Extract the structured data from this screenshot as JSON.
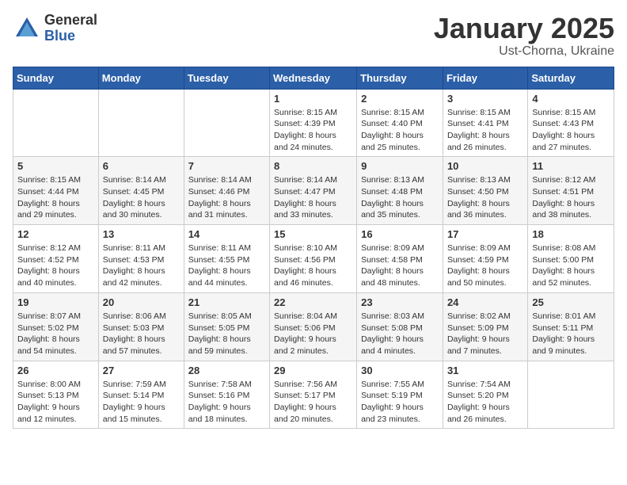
{
  "logo": {
    "general": "General",
    "blue": "Blue"
  },
  "title": {
    "month": "January 2025",
    "location": "Ust-Chorna, Ukraine"
  },
  "weekdays": [
    "Sunday",
    "Monday",
    "Tuesday",
    "Wednesday",
    "Thursday",
    "Friday",
    "Saturday"
  ],
  "weeks": [
    [
      {
        "day": "",
        "info": ""
      },
      {
        "day": "",
        "info": ""
      },
      {
        "day": "",
        "info": ""
      },
      {
        "day": "1",
        "info": "Sunrise: 8:15 AM\nSunset: 4:39 PM\nDaylight: 8 hours\nand 24 minutes."
      },
      {
        "day": "2",
        "info": "Sunrise: 8:15 AM\nSunset: 4:40 PM\nDaylight: 8 hours\nand 25 minutes."
      },
      {
        "day": "3",
        "info": "Sunrise: 8:15 AM\nSunset: 4:41 PM\nDaylight: 8 hours\nand 26 minutes."
      },
      {
        "day": "4",
        "info": "Sunrise: 8:15 AM\nSunset: 4:43 PM\nDaylight: 8 hours\nand 27 minutes."
      }
    ],
    [
      {
        "day": "5",
        "info": "Sunrise: 8:15 AM\nSunset: 4:44 PM\nDaylight: 8 hours\nand 29 minutes."
      },
      {
        "day": "6",
        "info": "Sunrise: 8:14 AM\nSunset: 4:45 PM\nDaylight: 8 hours\nand 30 minutes."
      },
      {
        "day": "7",
        "info": "Sunrise: 8:14 AM\nSunset: 4:46 PM\nDaylight: 8 hours\nand 31 minutes."
      },
      {
        "day": "8",
        "info": "Sunrise: 8:14 AM\nSunset: 4:47 PM\nDaylight: 8 hours\nand 33 minutes."
      },
      {
        "day": "9",
        "info": "Sunrise: 8:13 AM\nSunset: 4:48 PM\nDaylight: 8 hours\nand 35 minutes."
      },
      {
        "day": "10",
        "info": "Sunrise: 8:13 AM\nSunset: 4:50 PM\nDaylight: 8 hours\nand 36 minutes."
      },
      {
        "day": "11",
        "info": "Sunrise: 8:12 AM\nSunset: 4:51 PM\nDaylight: 8 hours\nand 38 minutes."
      }
    ],
    [
      {
        "day": "12",
        "info": "Sunrise: 8:12 AM\nSunset: 4:52 PM\nDaylight: 8 hours\nand 40 minutes."
      },
      {
        "day": "13",
        "info": "Sunrise: 8:11 AM\nSunset: 4:53 PM\nDaylight: 8 hours\nand 42 minutes."
      },
      {
        "day": "14",
        "info": "Sunrise: 8:11 AM\nSunset: 4:55 PM\nDaylight: 8 hours\nand 44 minutes."
      },
      {
        "day": "15",
        "info": "Sunrise: 8:10 AM\nSunset: 4:56 PM\nDaylight: 8 hours\nand 46 minutes."
      },
      {
        "day": "16",
        "info": "Sunrise: 8:09 AM\nSunset: 4:58 PM\nDaylight: 8 hours\nand 48 minutes."
      },
      {
        "day": "17",
        "info": "Sunrise: 8:09 AM\nSunset: 4:59 PM\nDaylight: 8 hours\nand 50 minutes."
      },
      {
        "day": "18",
        "info": "Sunrise: 8:08 AM\nSunset: 5:00 PM\nDaylight: 8 hours\nand 52 minutes."
      }
    ],
    [
      {
        "day": "19",
        "info": "Sunrise: 8:07 AM\nSunset: 5:02 PM\nDaylight: 8 hours\nand 54 minutes."
      },
      {
        "day": "20",
        "info": "Sunrise: 8:06 AM\nSunset: 5:03 PM\nDaylight: 8 hours\nand 57 minutes."
      },
      {
        "day": "21",
        "info": "Sunrise: 8:05 AM\nSunset: 5:05 PM\nDaylight: 8 hours\nand 59 minutes."
      },
      {
        "day": "22",
        "info": "Sunrise: 8:04 AM\nSunset: 5:06 PM\nDaylight: 9 hours\nand 2 minutes."
      },
      {
        "day": "23",
        "info": "Sunrise: 8:03 AM\nSunset: 5:08 PM\nDaylight: 9 hours\nand 4 minutes."
      },
      {
        "day": "24",
        "info": "Sunrise: 8:02 AM\nSunset: 5:09 PM\nDaylight: 9 hours\nand 7 minutes."
      },
      {
        "day": "25",
        "info": "Sunrise: 8:01 AM\nSunset: 5:11 PM\nDaylight: 9 hours\nand 9 minutes."
      }
    ],
    [
      {
        "day": "26",
        "info": "Sunrise: 8:00 AM\nSunset: 5:13 PM\nDaylight: 9 hours\nand 12 minutes."
      },
      {
        "day": "27",
        "info": "Sunrise: 7:59 AM\nSunset: 5:14 PM\nDaylight: 9 hours\nand 15 minutes."
      },
      {
        "day": "28",
        "info": "Sunrise: 7:58 AM\nSunset: 5:16 PM\nDaylight: 9 hours\nand 18 minutes."
      },
      {
        "day": "29",
        "info": "Sunrise: 7:56 AM\nSunset: 5:17 PM\nDaylight: 9 hours\nand 20 minutes."
      },
      {
        "day": "30",
        "info": "Sunrise: 7:55 AM\nSunset: 5:19 PM\nDaylight: 9 hours\nand 23 minutes."
      },
      {
        "day": "31",
        "info": "Sunrise: 7:54 AM\nSunset: 5:20 PM\nDaylight: 9 hours\nand 26 minutes."
      },
      {
        "day": "",
        "info": ""
      }
    ]
  ]
}
